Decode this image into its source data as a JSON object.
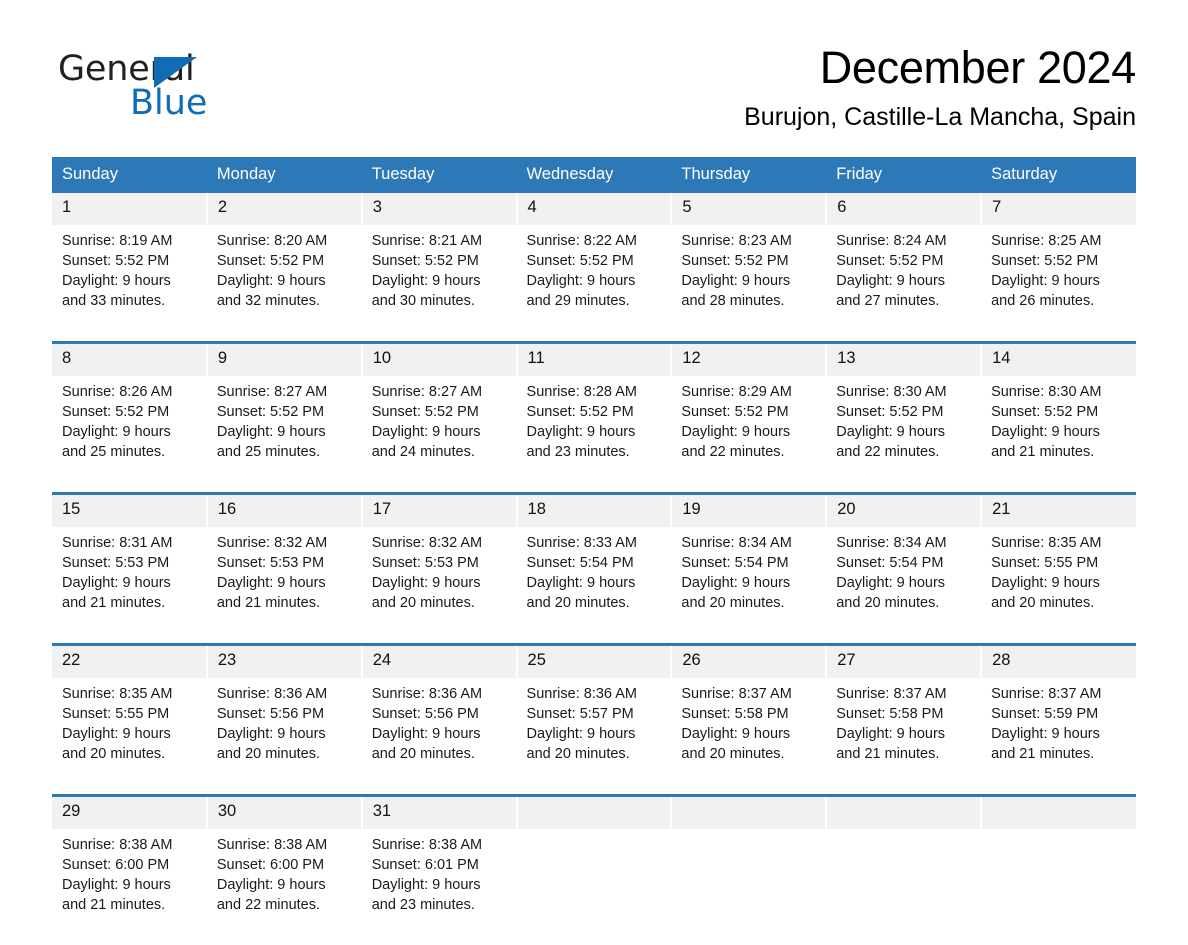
{
  "brand": {
    "name_part1": "General",
    "name_part2": "Blue",
    "triangle_color": "#0f6cb5",
    "accent_color": "#2d79b8"
  },
  "header": {
    "month_title": "December 2024",
    "location": "Burujon, Castille-La Mancha, Spain"
  },
  "calendar": {
    "weekday_headers": [
      "Sunday",
      "Monday",
      "Tuesday",
      "Wednesday",
      "Thursday",
      "Friday",
      "Saturday"
    ],
    "header_bg": "#2d79b8",
    "daynum_bg": "#f1f1f1",
    "weeks": [
      {
        "days": [
          {
            "num": "1",
            "sunrise": "Sunrise: 8:19 AM",
            "sunset": "Sunset: 5:52 PM",
            "daylight_1": "Daylight: 9 hours",
            "daylight_2": "and 33 minutes."
          },
          {
            "num": "2",
            "sunrise": "Sunrise: 8:20 AM",
            "sunset": "Sunset: 5:52 PM",
            "daylight_1": "Daylight: 9 hours",
            "daylight_2": "and 32 minutes."
          },
          {
            "num": "3",
            "sunrise": "Sunrise: 8:21 AM",
            "sunset": "Sunset: 5:52 PM",
            "daylight_1": "Daylight: 9 hours",
            "daylight_2": "and 30 minutes."
          },
          {
            "num": "4",
            "sunrise": "Sunrise: 8:22 AM",
            "sunset": "Sunset: 5:52 PM",
            "daylight_1": "Daylight: 9 hours",
            "daylight_2": "and 29 minutes."
          },
          {
            "num": "5",
            "sunrise": "Sunrise: 8:23 AM",
            "sunset": "Sunset: 5:52 PM",
            "daylight_1": "Daylight: 9 hours",
            "daylight_2": "and 28 minutes."
          },
          {
            "num": "6",
            "sunrise": "Sunrise: 8:24 AM",
            "sunset": "Sunset: 5:52 PM",
            "daylight_1": "Daylight: 9 hours",
            "daylight_2": "and 27 minutes."
          },
          {
            "num": "7",
            "sunrise": "Sunrise: 8:25 AM",
            "sunset": "Sunset: 5:52 PM",
            "daylight_1": "Daylight: 9 hours",
            "daylight_2": "and 26 minutes."
          }
        ]
      },
      {
        "days": [
          {
            "num": "8",
            "sunrise": "Sunrise: 8:26 AM",
            "sunset": "Sunset: 5:52 PM",
            "daylight_1": "Daylight: 9 hours",
            "daylight_2": "and 25 minutes."
          },
          {
            "num": "9",
            "sunrise": "Sunrise: 8:27 AM",
            "sunset": "Sunset: 5:52 PM",
            "daylight_1": "Daylight: 9 hours",
            "daylight_2": "and 25 minutes."
          },
          {
            "num": "10",
            "sunrise": "Sunrise: 8:27 AM",
            "sunset": "Sunset: 5:52 PM",
            "daylight_1": "Daylight: 9 hours",
            "daylight_2": "and 24 minutes."
          },
          {
            "num": "11",
            "sunrise": "Sunrise: 8:28 AM",
            "sunset": "Sunset: 5:52 PM",
            "daylight_1": "Daylight: 9 hours",
            "daylight_2": "and 23 minutes."
          },
          {
            "num": "12",
            "sunrise": "Sunrise: 8:29 AM",
            "sunset": "Sunset: 5:52 PM",
            "daylight_1": "Daylight: 9 hours",
            "daylight_2": "and 22 minutes."
          },
          {
            "num": "13",
            "sunrise": "Sunrise: 8:30 AM",
            "sunset": "Sunset: 5:52 PM",
            "daylight_1": "Daylight: 9 hours",
            "daylight_2": "and 22 minutes."
          },
          {
            "num": "14",
            "sunrise": "Sunrise: 8:30 AM",
            "sunset": "Sunset: 5:52 PM",
            "daylight_1": "Daylight: 9 hours",
            "daylight_2": "and 21 minutes."
          }
        ]
      },
      {
        "days": [
          {
            "num": "15",
            "sunrise": "Sunrise: 8:31 AM",
            "sunset": "Sunset: 5:53 PM",
            "daylight_1": "Daylight: 9 hours",
            "daylight_2": "and 21 minutes."
          },
          {
            "num": "16",
            "sunrise": "Sunrise: 8:32 AM",
            "sunset": "Sunset: 5:53 PM",
            "daylight_1": "Daylight: 9 hours",
            "daylight_2": "and 21 minutes."
          },
          {
            "num": "17",
            "sunrise": "Sunrise: 8:32 AM",
            "sunset": "Sunset: 5:53 PM",
            "daylight_1": "Daylight: 9 hours",
            "daylight_2": "and 20 minutes."
          },
          {
            "num": "18",
            "sunrise": "Sunrise: 8:33 AM",
            "sunset": "Sunset: 5:54 PM",
            "daylight_1": "Daylight: 9 hours",
            "daylight_2": "and 20 minutes."
          },
          {
            "num": "19",
            "sunrise": "Sunrise: 8:34 AM",
            "sunset": "Sunset: 5:54 PM",
            "daylight_1": "Daylight: 9 hours",
            "daylight_2": "and 20 minutes."
          },
          {
            "num": "20",
            "sunrise": "Sunrise: 8:34 AM",
            "sunset": "Sunset: 5:54 PM",
            "daylight_1": "Daylight: 9 hours",
            "daylight_2": "and 20 minutes."
          },
          {
            "num": "21",
            "sunrise": "Sunrise: 8:35 AM",
            "sunset": "Sunset: 5:55 PM",
            "daylight_1": "Daylight: 9 hours",
            "daylight_2": "and 20 minutes."
          }
        ]
      },
      {
        "days": [
          {
            "num": "22",
            "sunrise": "Sunrise: 8:35 AM",
            "sunset": "Sunset: 5:55 PM",
            "daylight_1": "Daylight: 9 hours",
            "daylight_2": "and 20 minutes."
          },
          {
            "num": "23",
            "sunrise": "Sunrise: 8:36 AM",
            "sunset": "Sunset: 5:56 PM",
            "daylight_1": "Daylight: 9 hours",
            "daylight_2": "and 20 minutes."
          },
          {
            "num": "24",
            "sunrise": "Sunrise: 8:36 AM",
            "sunset": "Sunset: 5:56 PM",
            "daylight_1": "Daylight: 9 hours",
            "daylight_2": "and 20 minutes."
          },
          {
            "num": "25",
            "sunrise": "Sunrise: 8:36 AM",
            "sunset": "Sunset: 5:57 PM",
            "daylight_1": "Daylight: 9 hours",
            "daylight_2": "and 20 minutes."
          },
          {
            "num": "26",
            "sunrise": "Sunrise: 8:37 AM",
            "sunset": "Sunset: 5:58 PM",
            "daylight_1": "Daylight: 9 hours",
            "daylight_2": "and 20 minutes."
          },
          {
            "num": "27",
            "sunrise": "Sunrise: 8:37 AM",
            "sunset": "Sunset: 5:58 PM",
            "daylight_1": "Daylight: 9 hours",
            "daylight_2": "and 21 minutes."
          },
          {
            "num": "28",
            "sunrise": "Sunrise: 8:37 AM",
            "sunset": "Sunset: 5:59 PM",
            "daylight_1": "Daylight: 9 hours",
            "daylight_2": "and 21 minutes."
          }
        ]
      },
      {
        "days": [
          {
            "num": "29",
            "sunrise": "Sunrise: 8:38 AM",
            "sunset": "Sunset: 6:00 PM",
            "daylight_1": "Daylight: 9 hours",
            "daylight_2": "and 21 minutes."
          },
          {
            "num": "30",
            "sunrise": "Sunrise: 8:38 AM",
            "sunset": "Sunset: 6:00 PM",
            "daylight_1": "Daylight: 9 hours",
            "daylight_2": "and 22 minutes."
          },
          {
            "num": "31",
            "sunrise": "Sunrise: 8:38 AM",
            "sunset": "Sunset: 6:01 PM",
            "daylight_1": "Daylight: 9 hours",
            "daylight_2": "and 23 minutes."
          },
          {
            "num": "",
            "sunrise": "",
            "sunset": "",
            "daylight_1": "",
            "daylight_2": ""
          },
          {
            "num": "",
            "sunrise": "",
            "sunset": "",
            "daylight_1": "",
            "daylight_2": ""
          },
          {
            "num": "",
            "sunrise": "",
            "sunset": "",
            "daylight_1": "",
            "daylight_2": ""
          },
          {
            "num": "",
            "sunrise": "",
            "sunset": "",
            "daylight_1": "",
            "daylight_2": ""
          }
        ]
      }
    ]
  }
}
